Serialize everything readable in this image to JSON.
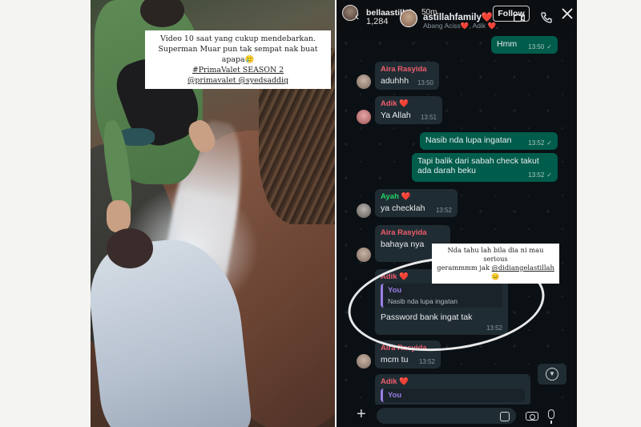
{
  "photo": {
    "caption_lines": [
      "Video 10 saat yang cukup mendebarkan.",
      "Superman Muar pun tak sempat nak buat apapa🥲",
      "#PrimaValet SEASON 2",
      "@primavalet @syedsaddiq"
    ]
  },
  "header": {
    "ig_username": "bellaastillah",
    "ig_time": "50m",
    "viewer_count": "1,284",
    "group_name": "astillahfamily❤️",
    "group_members": "Abang Aciss❤️, Adik ❤️,",
    "follow_label": "Follow"
  },
  "messages": [
    {
      "text": "Hmm",
      "time": "13:50",
      "check": "✓"
    },
    {
      "sender": "Aira Rasyida",
      "sender_color": "#f15c6d",
      "text": "aduhhh",
      "time": "13:50"
    },
    {
      "sender": "Adik ❤️",
      "sender_color": "#f15c6d",
      "text": "Ya Allah",
      "time": "13:51"
    },
    {
      "text": "Nasib nda lupa ingatan",
      "time": "13:52",
      "check": "✓"
    },
    {
      "text_line1": "Tapi balik dari sabah check takut",
      "text_line2": "ada darah beku",
      "time": "13:52",
      "check": "✓"
    },
    {
      "sender": "Ayah ❤️",
      "sender_color": "#25d366",
      "text": "ya checklah",
      "time": "13:52"
    },
    {
      "sender": "Aira Rasyida",
      "sender_color": "#f15c6d",
      "text": "bahaya nya"
    },
    {
      "sender": "Adik ❤️",
      "sender_color": "#f15c6d",
      "quote_name": "You",
      "quote_text": "Nasib nda lupa ingatan",
      "text": "Password bank ingat tak",
      "time": "13:52"
    },
    {
      "sender": "Aira Rasyida",
      "sender_color": "#f15c6d",
      "text": "mcm tu",
      "time": "13:52"
    },
    {
      "sender": "Adik ❤️",
      "sender_color": "#f15c6d",
      "quote_name": "You"
    }
  ],
  "annotation": {
    "line1": "Nda tahu lah bila dia ni mau serious",
    "line2_prefix": "gerammmm jak ",
    "line2_tag": "@didiangelastillah",
    "line2_suffix": " 😑"
  }
}
